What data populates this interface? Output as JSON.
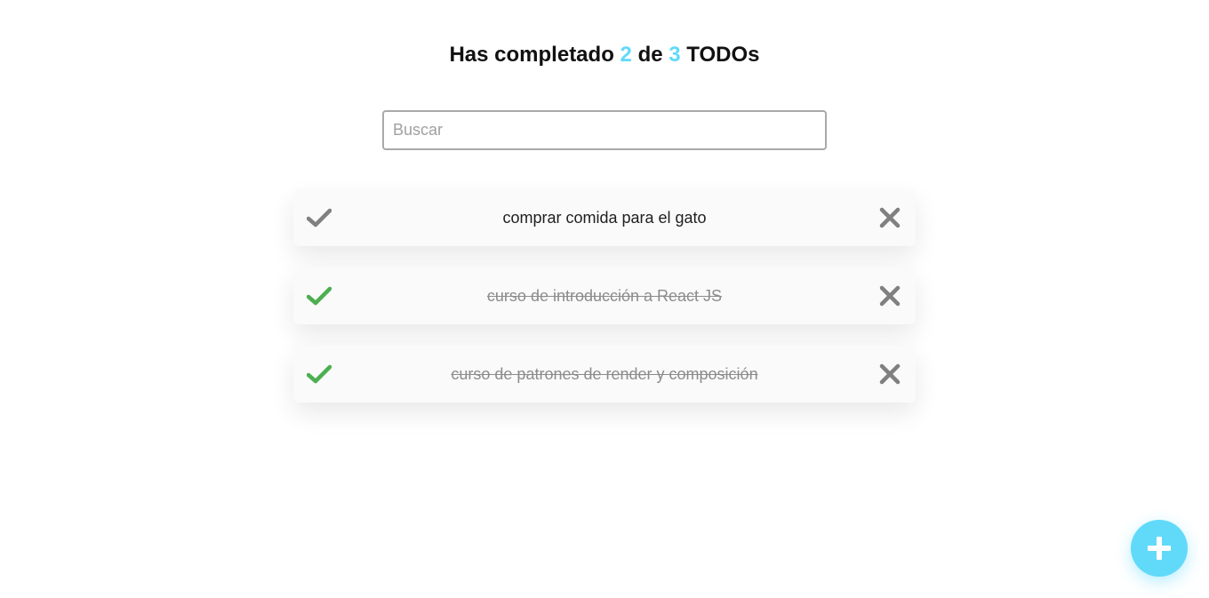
{
  "header": {
    "prefix": "Has completado",
    "completed_count": "2",
    "middle": "de",
    "total_count": "3",
    "suffix": "TODOs"
  },
  "search": {
    "placeholder": "Buscar",
    "value": ""
  },
  "todos": [
    {
      "text": "comprar comida para el gato",
      "completed": false,
      "check_icon": "check-icon",
      "delete_icon": "close-icon"
    },
    {
      "text": "curso de introducción a React JS",
      "completed": true,
      "check_icon": "check-icon",
      "delete_icon": "close-icon"
    },
    {
      "text": "curso de patrones de render y composición",
      "completed": true,
      "check_icon": "check-icon",
      "delete_icon": "close-icon"
    }
  ],
  "fab": {
    "icon": "plus-icon"
  },
  "colors": {
    "accent": "#61dafa",
    "check_done": "#4caf50",
    "check_pending": "#808080",
    "delete": "#808080",
    "completed_text": "#8c8c8c"
  }
}
